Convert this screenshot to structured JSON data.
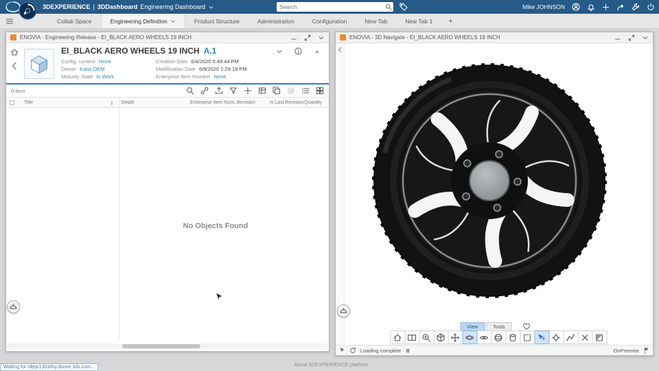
{
  "topbar": {
    "brand": "3DEXPERIENCE",
    "separator": "|",
    "app": "3DDashboard",
    "dashboard_name": "Engineering Dashboard",
    "search_placeholder": "Search",
    "user_name": "Mike JOHNSON"
  },
  "tabbar": {
    "tabs": [
      {
        "label": "Collab Space"
      },
      {
        "label": "Engineering Definition"
      },
      {
        "label": "Product Structure"
      },
      {
        "label": "Administration"
      },
      {
        "label": "Configuration"
      },
      {
        "label": "New Tab"
      },
      {
        "label": "New Tab 1"
      }
    ],
    "add_tab": "+"
  },
  "left_panel": {
    "window_title": "ENOVIA - Engineering Release - EI_BLACK AERO WHEELS 19 INCH",
    "item_title": "EI_BLACK AERO WHEELS 19 INCH",
    "item_revision": "A.1",
    "fields": {
      "config_context_label": "Config. context",
      "config_context_value": "None",
      "owner_label": "Owner",
      "owner_value": "Katia OEM",
      "maturity_label": "Maturity State",
      "maturity_value": "In Work",
      "creation_label": "Creation Date",
      "creation_value": "6/4/2020 5:49:44 PM",
      "modification_label": "Modification Date",
      "modification_value": "6/8/2020 1:29:19 PM",
      "enterprise_label": "Enterprise Item Number",
      "enterprise_value": "None"
    },
    "item_count": "0 item",
    "columns": [
      "Title",
      "Depth",
      "Enterprise Item Num...",
      "Revision",
      "Is Last Revision",
      "Quantity"
    ],
    "empty_message": "No Objects Found"
  },
  "right_panel": {
    "window_title": "ENOVIA - 3D Navigate - EI_BLACK AERO WHEELS 19 INCH",
    "view_tab": "View",
    "tools_tab": "Tools",
    "status_text": "Loading complete",
    "deployment": "OnPremise"
  },
  "footer": {
    "loading_hint": "Waiting for rdepr1303dsy.dsone.3ds.com...",
    "about_text": "About 3DEXPERIENCE platform"
  },
  "colors": {
    "topbar": "#265a87",
    "accent_link": "#2a85c7",
    "rule": "#2e7dc9",
    "enovia_icon": "#f08a30",
    "active_tool": "#cfe4f8"
  },
  "icons": {
    "top_bar": [
      "profile-icon",
      "notifications-icon",
      "add-icon",
      "share-icon",
      "tools-icon",
      "power-icon"
    ],
    "left_toolbar": [
      "search-icon",
      "link-icon",
      "export-icon",
      "filter-icon",
      "add-icon",
      "table-icon",
      "duplicate-icon",
      "settings-icon",
      "list-view-icon",
      "grid-view-icon"
    ],
    "viewer_toolbar": [
      "home-view-icon",
      "multi-view-icon",
      "zoom-icon",
      "iso-view-icon",
      "pan-icon",
      "orbit-icon",
      "look-at-icon",
      "shaded-sphere-icon",
      "cylinder-icon",
      "ghost-box-icon",
      "multi-select-icon",
      "center-target-icon",
      "measure-icon",
      "delete-icon",
      "section-box-icon"
    ]
  }
}
